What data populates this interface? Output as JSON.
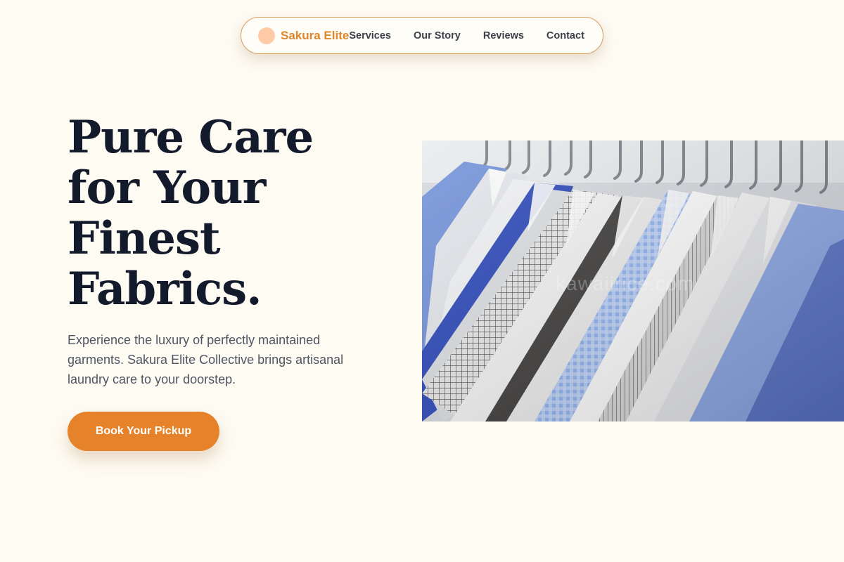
{
  "nav": {
    "brand": "Sakura Elite",
    "links": [
      "Services",
      "Our Story",
      "Reviews",
      "Contact"
    ]
  },
  "hero": {
    "headline": "Pure Care for Your Finest Fabrics.",
    "subtext": "Experience the luxury of perfectly maintained garments. Sakura Elite Collective brings artisanal laundry care to your doorstep.",
    "cta": "Book Your Pickup",
    "image_watermark": "kawaiirice.com"
  },
  "colors": {
    "background": "#fefbf3",
    "accent": "#e5822a",
    "brand_text": "#e0852a",
    "brand_dot": "#ffcba6",
    "heading": "#131a2b",
    "body_text": "#4f5562",
    "nav_text": "#3b3f4a",
    "nav_border": "#d99a5b"
  }
}
